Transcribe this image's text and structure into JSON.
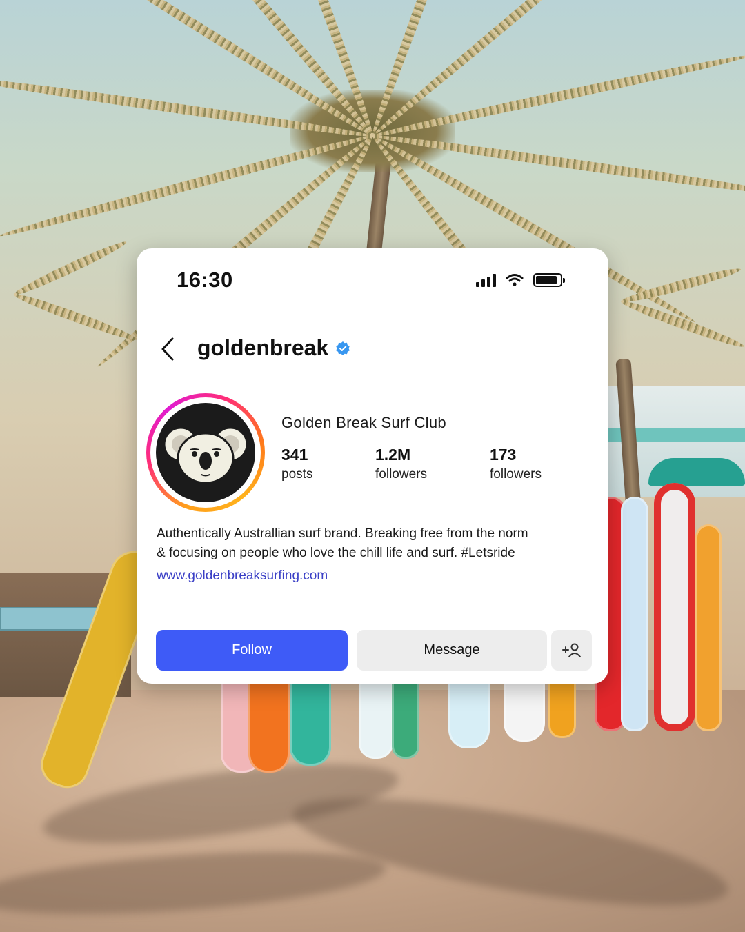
{
  "status_bar": {
    "time": "16:30"
  },
  "profile": {
    "username": "goldenbreak",
    "display_name": "Golden Break Surf Club",
    "verified": true,
    "stats": [
      {
        "value": "341",
        "label": "posts"
      },
      {
        "value": "1.2M",
        "label": "followers"
      },
      {
        "value": "173",
        "label": "followers"
      }
    ],
    "bio_line1": "Authentically Australlian surf brand. Breaking free from the norm",
    "bio_line2": "& focusing on people who love the chill life and surf. #Letsride",
    "website": "www.goldenbreaksurfing.com"
  },
  "actions": {
    "follow_label": "Follow",
    "message_label": "Message"
  },
  "icons": {
    "back": "chevron-left-icon",
    "verified": "verified-badge-icon",
    "signal": "cellular-signal-icon",
    "wifi": "wifi-icon",
    "battery": "battery-icon",
    "add_user": "add-user-icon",
    "avatar": "koala-logo"
  },
  "colors": {
    "follow_button": "#3e5bf7",
    "link": "#3a3fc6",
    "verified_badge": "#3897f0",
    "story_ring": [
      "#ff9f1c",
      "#ff2d78",
      "#e01bd0"
    ]
  }
}
